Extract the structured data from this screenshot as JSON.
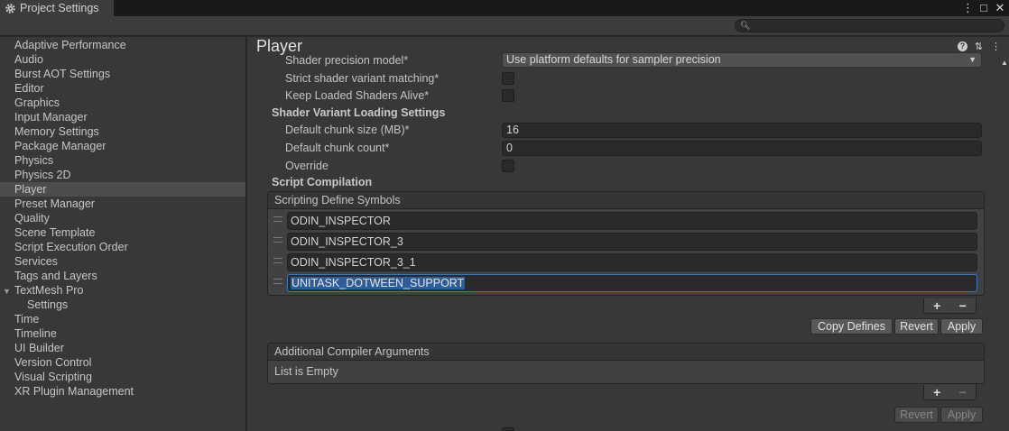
{
  "window": {
    "tab_title": "Project Settings",
    "buttons": [
      "⋮",
      "□",
      "✕"
    ]
  },
  "search": {
    "placeholder": ""
  },
  "sidebar": {
    "items": [
      {
        "label": "Adaptive Performance"
      },
      {
        "label": "Audio"
      },
      {
        "label": "Burst AOT Settings"
      },
      {
        "label": "Editor"
      },
      {
        "label": "Graphics"
      },
      {
        "label": "Input Manager"
      },
      {
        "label": "Memory Settings"
      },
      {
        "label": "Package Manager"
      },
      {
        "label": "Physics"
      },
      {
        "label": "Physics 2D"
      },
      {
        "label": "Player",
        "selected": true
      },
      {
        "label": "Preset Manager"
      },
      {
        "label": "Quality"
      },
      {
        "label": "Scene Template"
      },
      {
        "label": "Script Execution Order"
      },
      {
        "label": "Services"
      },
      {
        "label": "Tags and Layers"
      },
      {
        "label": "TextMesh Pro",
        "group": true
      },
      {
        "label": "Settings",
        "child": true
      },
      {
        "label": "Time"
      },
      {
        "label": "Timeline"
      },
      {
        "label": "UI Builder"
      },
      {
        "label": "Version Control"
      },
      {
        "label": "Visual Scripting"
      },
      {
        "label": "XR Plugin Management"
      }
    ]
  },
  "main": {
    "title": "Player",
    "title_icons": [
      "?",
      "⇅",
      "⋮"
    ],
    "shader_precision": {
      "label": "Shader precision model*",
      "value": "Use platform defaults for sampler precision"
    },
    "strict_shader": {
      "label": "Strict shader variant matching*",
      "checked": false
    },
    "keep_loaded": {
      "label": "Keep Loaded Shaders Alive*",
      "checked": false
    },
    "variant_loading_header": "Shader Variant Loading Settings",
    "chunk_size": {
      "label": "Default chunk size (MB)*",
      "value": "16"
    },
    "chunk_count": {
      "label": "Default chunk count*",
      "value": "0"
    },
    "override": {
      "label": "Override",
      "checked": false
    },
    "script_compilation_header": "Script Compilation",
    "define_symbols": {
      "header": "Scripting Define Symbols",
      "items": [
        "ODIN_INSPECTOR",
        "ODIN_INSPECTOR_3",
        "ODIN_INSPECTOR_3_1",
        "UNITASK_DOTWEEN_SUPPORT"
      ],
      "active_index": 3
    },
    "plus": "+",
    "minus": "−",
    "copy_defines": "Copy Defines",
    "revert": "Revert",
    "apply": "Apply",
    "compiler_args": {
      "header": "Additional Compiler Arguments",
      "empty_text": "List is Empty"
    }
  }
}
